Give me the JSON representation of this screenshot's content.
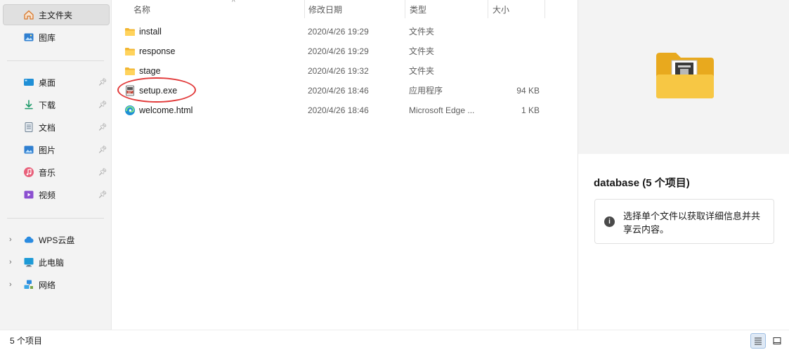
{
  "sidebar": {
    "top_items": [
      {
        "label": "主文件夹",
        "icon": "home-icon"
      },
      {
        "label": "图库",
        "icon": "gallery-icon"
      }
    ],
    "quick_access": [
      {
        "label": "桌面",
        "icon": "desktop-icon",
        "pinned": true
      },
      {
        "label": "下载",
        "icon": "download-icon",
        "pinned": true
      },
      {
        "label": "文档",
        "icon": "document-icon",
        "pinned": true
      },
      {
        "label": "图片",
        "icon": "pictures-icon",
        "pinned": true
      },
      {
        "label": "音乐",
        "icon": "music-icon",
        "pinned": true
      },
      {
        "label": "视频",
        "icon": "video-icon",
        "pinned": true
      }
    ],
    "tree_items": [
      {
        "label": "WPS云盘",
        "icon": "cloud-icon"
      },
      {
        "label": "此电脑",
        "icon": "computer-icon"
      },
      {
        "label": "网络",
        "icon": "network-icon"
      }
    ]
  },
  "columns": {
    "name": "名称",
    "modified": "修改日期",
    "type": "类型",
    "size": "大小"
  },
  "files": [
    {
      "name": "install",
      "modified": "2020/4/26 19:29",
      "type": "文件夹",
      "size": "",
      "icon": "folder-icon"
    },
    {
      "name": "response",
      "modified": "2020/4/26 19:29",
      "type": "文件夹",
      "size": "",
      "icon": "folder-icon"
    },
    {
      "name": "stage",
      "modified": "2020/4/26 19:32",
      "type": "文件夹",
      "size": "",
      "icon": "folder-icon"
    },
    {
      "name": "setup.exe",
      "modified": "2020/4/26 18:46",
      "type": "应用程序",
      "size": "94 KB",
      "icon": "exe-icon"
    },
    {
      "name": "welcome.html",
      "modified": "2020/4/26 18:46",
      "type": "Microsoft Edge ...",
      "size": "1 KB",
      "icon": "edge-icon"
    }
  ],
  "details": {
    "folder_title": "database (5 个项目)",
    "info_text": "选择单个文件以获取详细信息并共享云内容。"
  },
  "status": {
    "item_count": "5 个项目"
  },
  "colors": {
    "folder": "#f5c342",
    "annotation_circle": "#e23b3b",
    "selected_bg": "#e0e0e0"
  }
}
